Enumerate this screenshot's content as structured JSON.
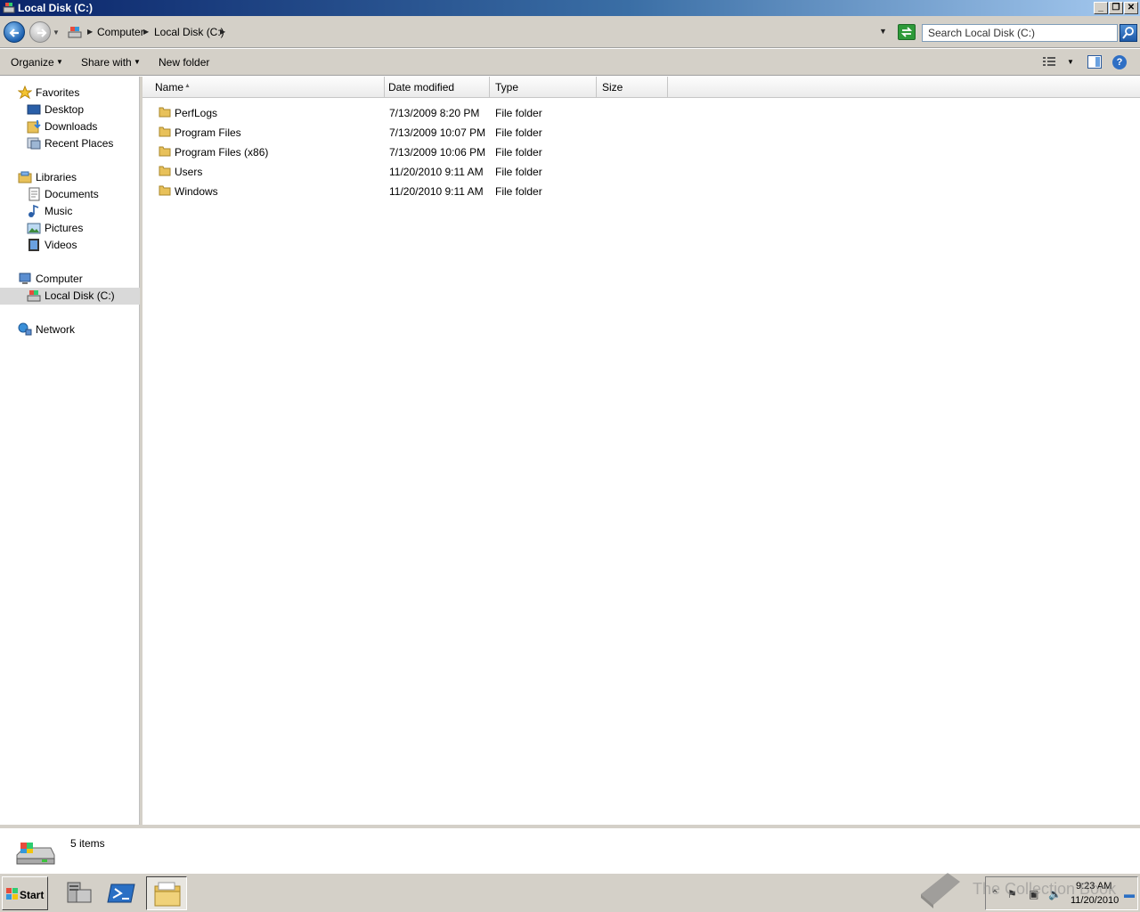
{
  "window": {
    "title": "Local Disk (C:)",
    "controls": {
      "minimize": "_",
      "restore": "❐",
      "close": "✕"
    }
  },
  "address_bar": {
    "breadcrumbs": [
      "Computer",
      "Local Disk (C:)"
    ],
    "search_placeholder": "Search Local Disk (C:)"
  },
  "toolbar": {
    "organize": "Organize",
    "share_with": "Share with",
    "new_folder": "New folder"
  },
  "nav": {
    "favorites": {
      "label": "Favorites",
      "items": [
        "Desktop",
        "Downloads",
        "Recent Places"
      ]
    },
    "libraries": {
      "label": "Libraries",
      "items": [
        "Documents",
        "Music",
        "Pictures",
        "Videos"
      ]
    },
    "computer": {
      "label": "Computer",
      "items": [
        "Local Disk (C:)"
      ]
    },
    "network": {
      "label": "Network"
    },
    "selected": "Local Disk (C:)"
  },
  "columns": [
    "Name",
    "Date modified",
    "Type",
    "Size"
  ],
  "sort_column": "Name",
  "files": [
    {
      "name": "PerfLogs",
      "date": "7/13/2009 8:20 PM",
      "type": "File folder",
      "size": ""
    },
    {
      "name": "Program Files",
      "date": "7/13/2009 10:07 PM",
      "type": "File folder",
      "size": ""
    },
    {
      "name": "Program Files (x86)",
      "date": "7/13/2009 10:06 PM",
      "type": "File folder",
      "size": ""
    },
    {
      "name": "Users",
      "date": "11/20/2010 9:11 AM",
      "type": "File folder",
      "size": ""
    },
    {
      "name": "Windows",
      "date": "11/20/2010 9:11 AM",
      "type": "File folder",
      "size": ""
    }
  ],
  "details": {
    "item_count": "5 items"
  },
  "taskbar": {
    "start": "Start",
    "time": "9:23 AM",
    "date": "11/20/2010"
  },
  "watermark": "The Collection Book",
  "colors": {
    "title_bar": "#0a246a",
    "chrome": "#d4d0c8",
    "folder": "#e8c15a",
    "selection": "#d9d9d9"
  }
}
